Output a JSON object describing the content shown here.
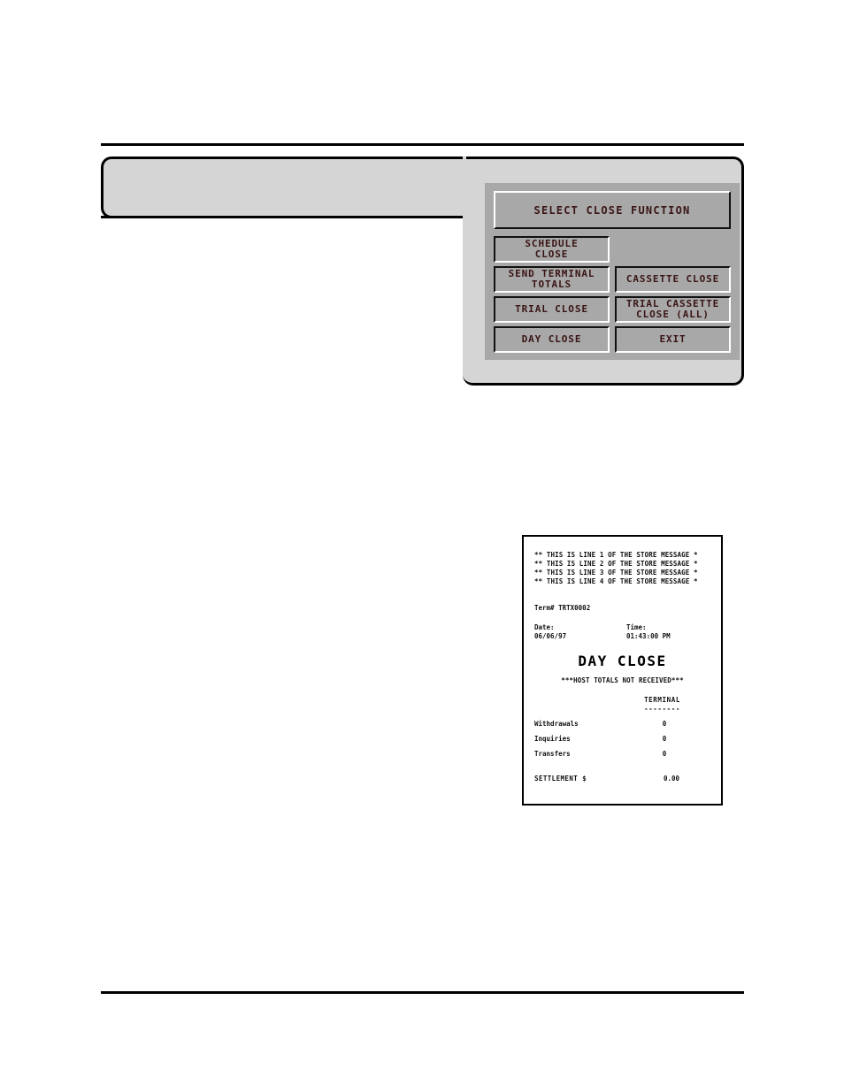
{
  "page": {
    "rule_top": "",
    "rule_bottom": ""
  },
  "atm": {
    "title": "SELECT CLOSE FUNCTION",
    "rows": [
      [
        {
          "label": "SCHEDULE\nCLOSE",
          "empty": false
        },
        {
          "label": "",
          "empty": true
        }
      ],
      [
        {
          "label": "SEND TERMINAL\nTOTALS",
          "empty": false
        },
        {
          "label": "CASSETTE CLOSE",
          "empty": false
        }
      ],
      [
        {
          "label": "TRIAL CLOSE",
          "empty": false
        },
        {
          "label": "TRIAL CASSETTE\nCLOSE (ALL)",
          "empty": false
        }
      ],
      [
        {
          "label": "DAY CLOSE",
          "empty": false
        },
        {
          "label": "EXIT",
          "empty": false
        }
      ]
    ],
    "colors": {
      "screen_bg": "#a8a8a8",
      "bezel_bg": "#d5d5d5",
      "text": "#3a1414"
    }
  },
  "receipt": {
    "store_message": "** THIS IS LINE 1 OF THE STORE MESSAGE *\n** THIS IS LINE 2 OF THE STORE MESSAGE *\n** THIS IS LINE 3 OF THE STORE MESSAGE *\n** THIS IS LINE 4 OF THE STORE MESSAGE *",
    "terminal_id": "Term# TRTX0002",
    "date_label": "Date:",
    "date_value": "06/06/97",
    "time_label": "Time:",
    "time_value": "01:43:00 PM",
    "heading": "DAY CLOSE",
    "note": "***HOST TOTALS NOT RECEIVED***",
    "column_header": "TERMINAL",
    "column_rule": "--------",
    "lines": [
      {
        "label": "Withdrawals",
        "value": "0"
      },
      {
        "label": "Inquiries",
        "value": "0"
      },
      {
        "label": "Transfers",
        "value": "0"
      }
    ],
    "settlement_label": "SETTLEMENT $",
    "settlement_value": "0.00"
  }
}
